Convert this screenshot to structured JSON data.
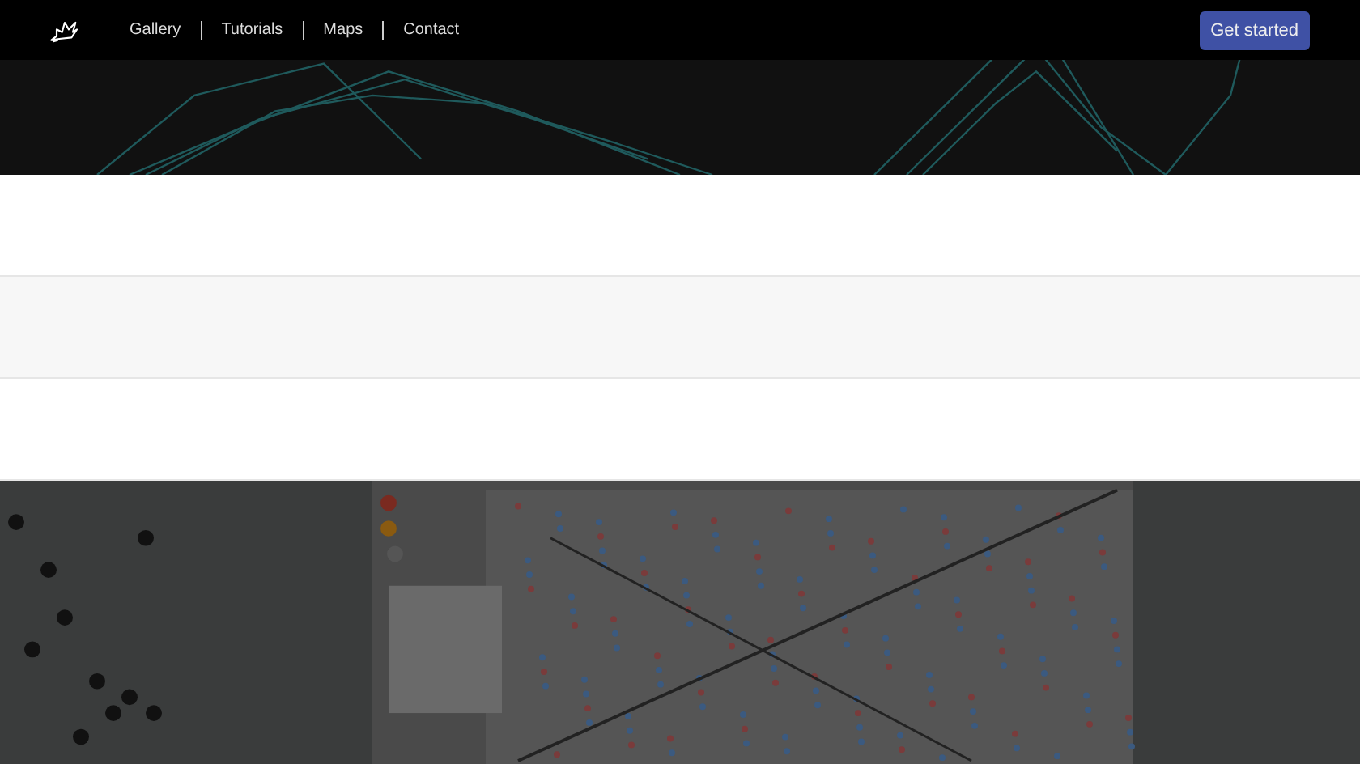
{
  "nav": {
    "items": [
      {
        "label": "Gallery"
      },
      {
        "label": "Tutorials"
      },
      {
        "label": "Maps"
      },
      {
        "label": "Contact"
      }
    ],
    "cta": "Get started"
  }
}
